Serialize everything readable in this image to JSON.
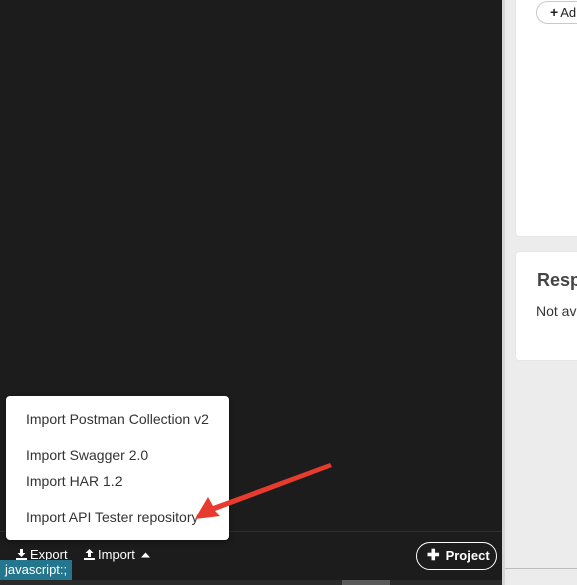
{
  "right_panel": {
    "add_button": "Ad",
    "response_title": "Resp",
    "response_text": "Not av"
  },
  "import_menu": {
    "items": [
      "Import Postman Collection v2",
      "Import Swagger 2.0",
      "Import HAR 1.2",
      "Import API Tester repository"
    ]
  },
  "toolbar": {
    "export_label": "Export",
    "import_label": "Import",
    "project_label": "Project"
  },
  "status_bar": {
    "url": "javascript:;"
  },
  "colors": {
    "left_background": "#1c1c1c",
    "right_background": "#ececec",
    "annotation_arrow": "#e63b2e",
    "status_url_background": "#23768d"
  }
}
